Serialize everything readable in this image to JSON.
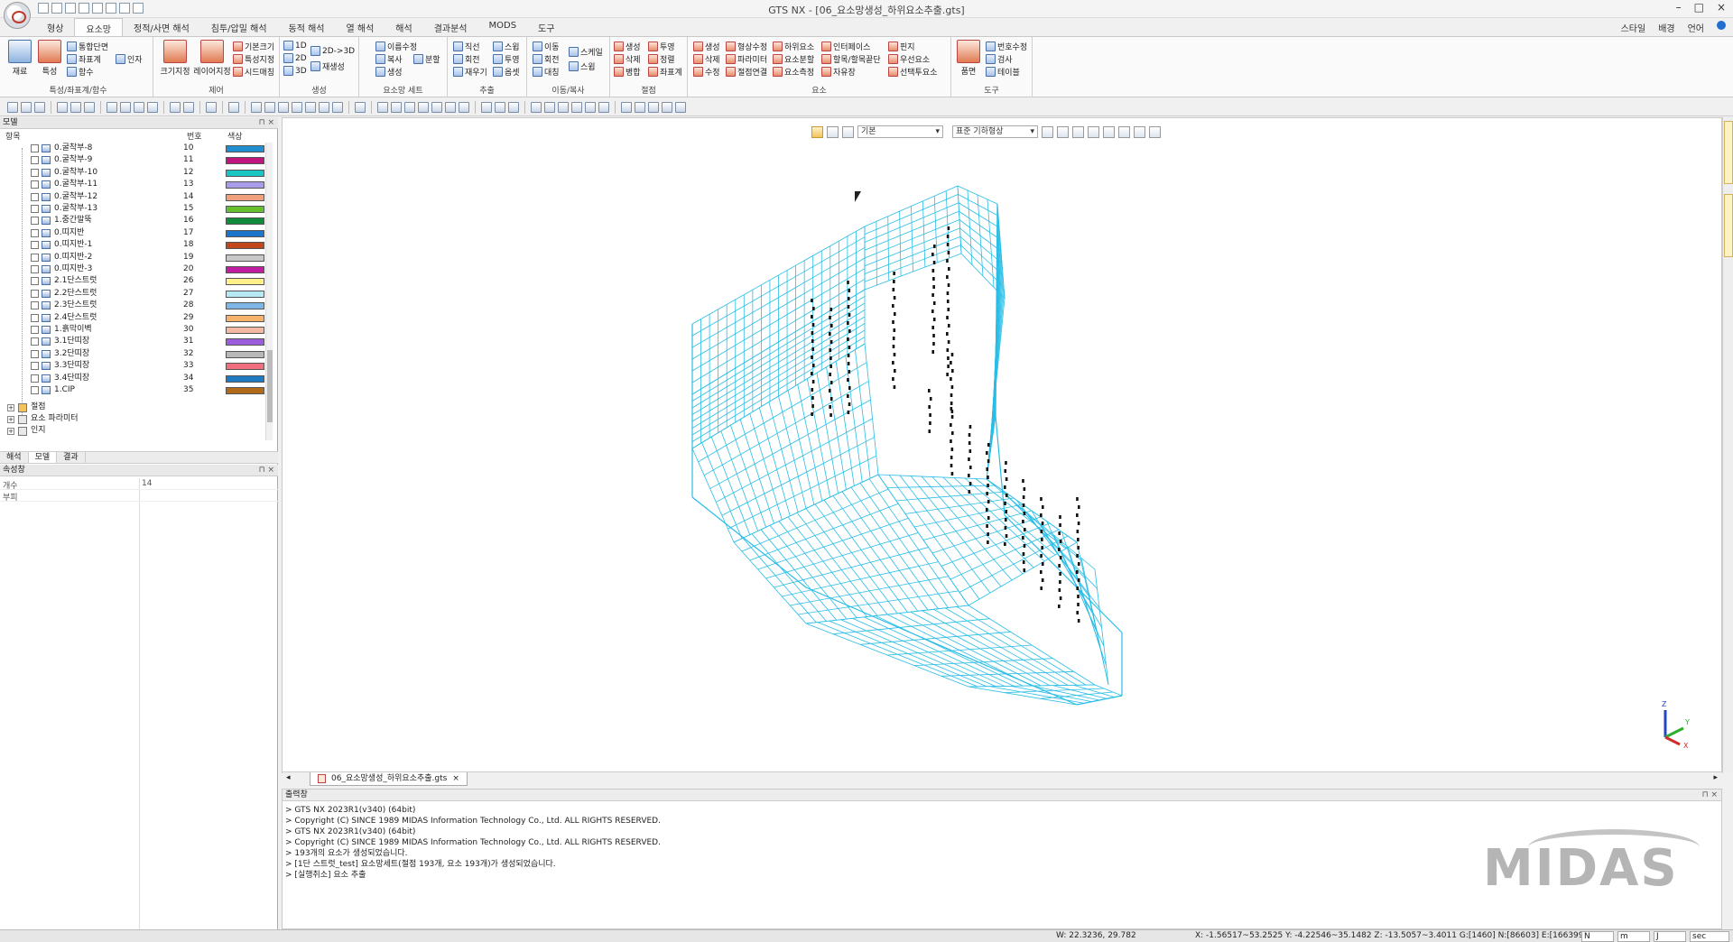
{
  "window": {
    "title": "GTS NX - [06_요소망생성_하위요소추출.gts]",
    "controls": [
      "–",
      "□",
      "×"
    ]
  },
  "ribbon_tabs": [
    "형상",
    "요소망",
    "정적/사면 해석",
    "침투/압밀 해석",
    "동적 해석",
    "열 해석",
    "해석",
    "결과분석",
    "MODS",
    "도구"
  ],
  "ribbon_active_tab": "요소망",
  "ribbon_right": [
    "스타일",
    "배경",
    "언어"
  ],
  "ribbon_groups": [
    {
      "label": "특성/좌표계/함수",
      "big": [
        "재료",
        "특성"
      ],
      "small": [
        "통합단면",
        "좌표계",
        "함수",
        "인자"
      ]
    },
    {
      "label": "제어",
      "big": [
        "크기지정",
        "레이어지정"
      ],
      "small": [
        "기본크기",
        "특성지정",
        "시드매칭"
      ]
    },
    {
      "label": "생성",
      "small": [
        "1D",
        "2D",
        "3D",
        "2D->3D",
        "재생성"
      ]
    },
    {
      "label": "요소망 세트",
      "small": [
        "이름수정",
        "복사",
        "분할",
        "생성"
      ]
    },
    {
      "label": "추출",
      "small": [
        "직선",
        "회전",
        "재우기",
        "스윕",
        "투영",
        "옵셋"
      ]
    },
    {
      "label": "이동/복사",
      "small": [
        "이동",
        "회전",
        "대칭",
        "스케일",
        "스윕"
      ]
    },
    {
      "label": "절점",
      "small": [
        "생성",
        "삭제",
        "병합",
        "투영",
        "정렬",
        "좌표계"
      ]
    },
    {
      "label": "요소",
      "small": [
        "생성",
        "삭제",
        "수정",
        "형상수정",
        "파라미터",
        "절점연결",
        "하위요소",
        "요소분할",
        "요소측정",
        "인터페이스",
        "할목/할목끝단",
        "자유장",
        "핀지",
        "우선요소",
        "선택투요소"
      ]
    },
    {
      "label": "도구",
      "big": [
        "품면"
      ],
      "small": [
        "번호수정",
        "검사",
        "테이블"
      ]
    }
  ],
  "tree": {
    "panel_title": "모델",
    "headers": [
      "항목",
      "번호",
      "색상"
    ],
    "rows": [
      {
        "name": "0.굴착부-8",
        "num": "10",
        "color": "#1f8fd0"
      },
      {
        "name": "0.굴착부-9",
        "num": "11",
        "color": "#c0147e"
      },
      {
        "name": "0.굴착부-10",
        "num": "12",
        "color": "#19c5c3"
      },
      {
        "name": "0.굴착부-11",
        "num": "13",
        "color": "#a89be8"
      },
      {
        "name": "0.굴착부-12",
        "num": "14",
        "color": "#f0a07c"
      },
      {
        "name": "0.굴착부-13",
        "num": "15",
        "color": "#66bf2c"
      },
      {
        "name": "1.중간말뚝",
        "num": "16",
        "color": "#128a3c"
      },
      {
        "name": "0.띠지반",
        "num": "17",
        "color": "#1c75c9"
      },
      {
        "name": "0.띠지반-1",
        "num": "18",
        "color": "#c0461c"
      },
      {
        "name": "0.띠지반-2",
        "num": "19",
        "color": "#c8c8c8"
      },
      {
        "name": "0.띠지반-3",
        "num": "20",
        "color": "#c01da0"
      },
      {
        "name": "2.1단스트럿",
        "num": "26",
        "color": "#fff08a"
      },
      {
        "name": "2.2단스트럿",
        "num": "27",
        "color": "#b6e9f4"
      },
      {
        "name": "2.3단스트럿",
        "num": "28",
        "color": "#7fb6e6"
      },
      {
        "name": "2.4단스트럿",
        "num": "29",
        "color": "#f6b36b"
      },
      {
        "name": "1.흙막이벽",
        "num": "30",
        "color": "#f3b9a2"
      },
      {
        "name": "3.1단띠장",
        "num": "31",
        "color": "#9b5ddc"
      },
      {
        "name": "3.2단띠장",
        "num": "32",
        "color": "#b8b8b8"
      },
      {
        "name": "3.3단띠장",
        "num": "33",
        "color": "#f06e7d"
      },
      {
        "name": "3.4단띠장",
        "num": "34",
        "color": "#1f7ac2"
      },
      {
        "name": "1.CIP",
        "num": "35",
        "color": "#b06a1a"
      }
    ],
    "nodes": [
      "절점",
      "요소 파라미터",
      "인지"
    ],
    "tabs": [
      "해석",
      "모델",
      "결과"
    ],
    "active_tab": "모델"
  },
  "properties": {
    "panel_title": "속성창",
    "rows": [
      {
        "key": "개수",
        "value": "14"
      },
      {
        "key": "부피",
        "value": ""
      }
    ]
  },
  "viewport": {
    "mode_combo": "기본",
    "render_combo": "표준 기하형상"
  },
  "document_tab": "06_요소망생성_하위요소추출.gts",
  "output": {
    "panel_title": "출력창",
    "lines": [
      "> GTS NX 2023R1(v340) (64bit)",
      "> Copyright (C) SINCE 1989 MIDAS Information Technology Co., Ltd. ALL RIGHTS RESERVED.",
      "> GTS NX 2023R1(v340) (64bit)",
      "> Copyright (C) SINCE 1989 MIDAS Information Technology Co., Ltd. ALL RIGHTS RESERVED.",
      "> 193개의 요소가 생성되었습니다.",
      "> [1단 스트럿_test] 요소망세트(절점 193개, 요소 193개)가 생성되었습니다.",
      "> [실행취소] 요소 추출"
    ],
    "brand": "MIDAS"
  },
  "status": {
    "size": "W: 22.3236, 29.782",
    "coords": "X: -1.56517~53.2525 Y: -4.22546~35.1482 Z: -13.5057~3.4011 G:[1460] N:[86603] E:[166399]",
    "units": [
      "N",
      "m",
      "J",
      "sec"
    ]
  },
  "colors": {
    "mesh": "#29bde6",
    "accent": "#1f6fd1"
  }
}
